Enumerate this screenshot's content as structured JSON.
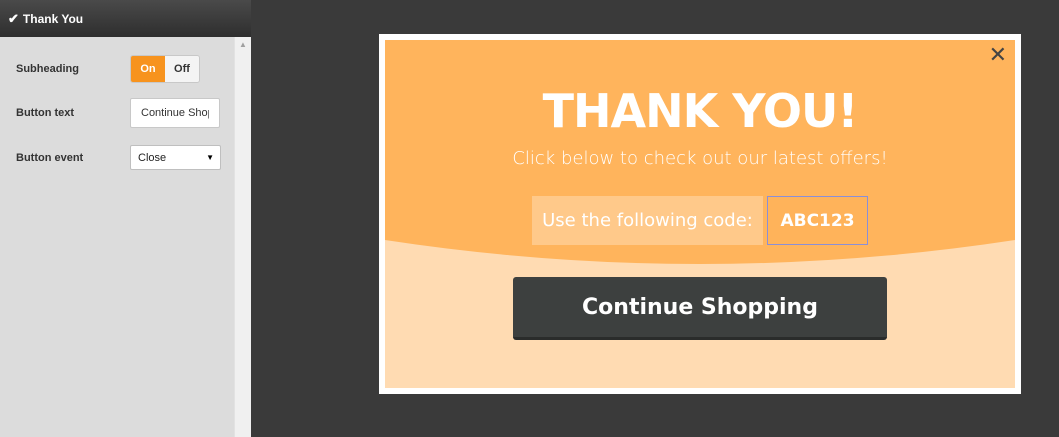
{
  "panel": {
    "title": "Thank You",
    "check_icon": "✔",
    "fields": {
      "subheading": {
        "label": "Subheading",
        "on_label": "On",
        "off_label": "Off",
        "selected": "On"
      },
      "button_text": {
        "label": "Button text",
        "value": "Continue Shopping"
      },
      "button_event": {
        "label": "Button event",
        "value": "Close"
      }
    }
  },
  "popup": {
    "close_icon": "✕",
    "headline": "THANK YOU!",
    "subheadline": "Click below to check out our latest offers!",
    "code_label": "Use the following code:",
    "code_value": "ABC123",
    "button_label": "Continue Shopping"
  },
  "colors": {
    "accent": "#f7931e",
    "popup_top": "#ffb45c",
    "popup_bottom": "#ffdbb2",
    "button": "#3d403f"
  }
}
